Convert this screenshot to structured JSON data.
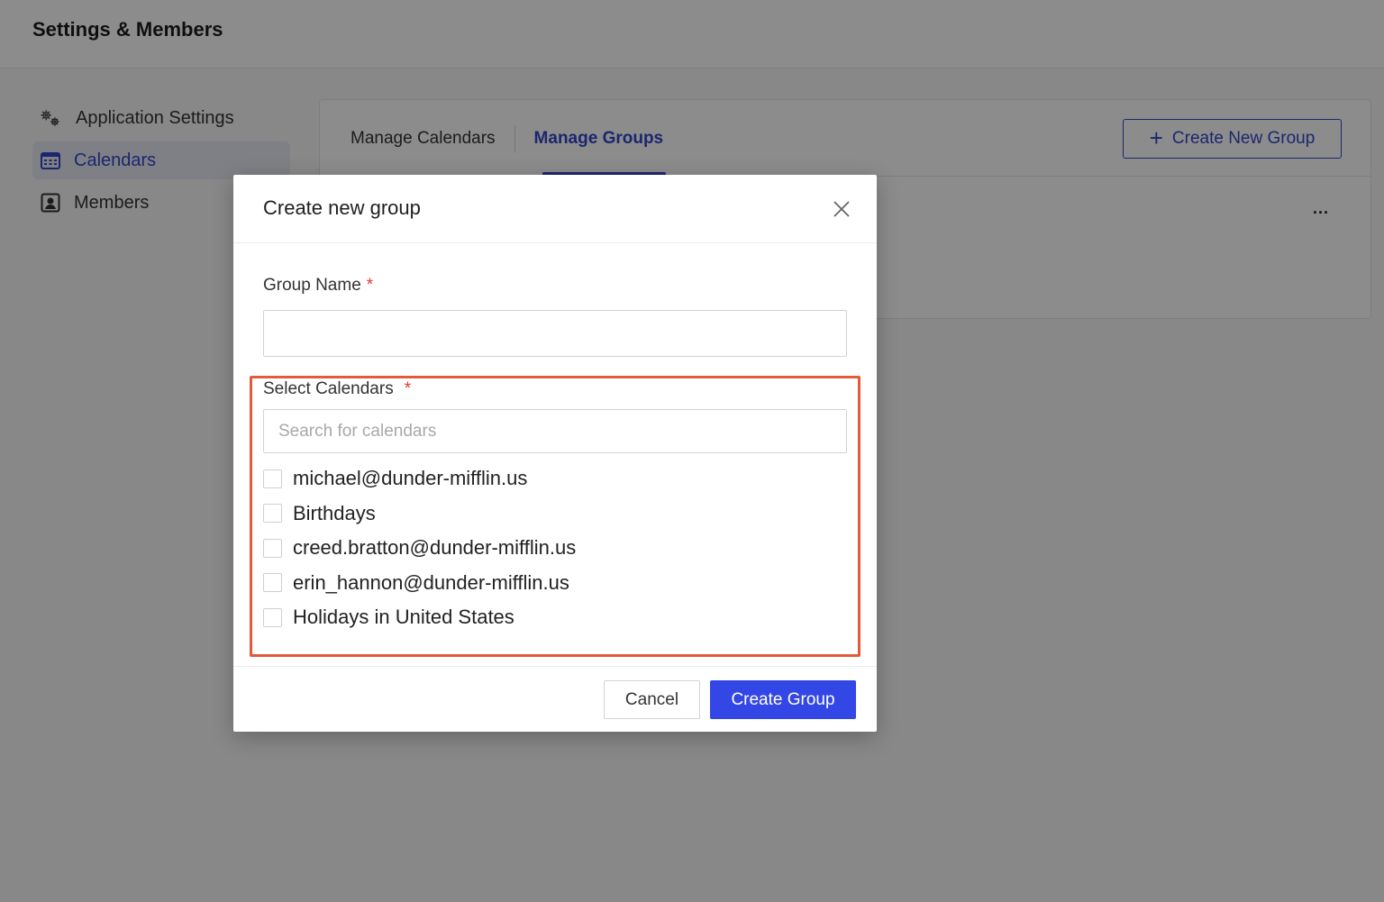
{
  "header": {
    "title": "Settings & Members"
  },
  "sidebar": {
    "items": [
      {
        "label": "Application Settings",
        "icon": "gears-icon",
        "active": false
      },
      {
        "label": "Calendars",
        "icon": "calendar-icon",
        "active": true
      },
      {
        "label": "Members",
        "icon": "member-icon",
        "active": false
      }
    ]
  },
  "tabs": [
    {
      "label": "Manage Calendars",
      "active": false
    },
    {
      "label": "Manage Groups",
      "active": true
    }
  ],
  "actions": {
    "create_new_group_label": "Create New Group",
    "more_label": "..."
  },
  "modal": {
    "title": "Create new group",
    "group_name_label": "Group Name",
    "group_name_value": "",
    "select_calendars_label": "Select Calendars",
    "required_mark": "*",
    "search_placeholder": "Search for calendars",
    "calendars": [
      {
        "label": "michael@dunder-mifflin.us",
        "checked": false
      },
      {
        "label": "Birthdays",
        "checked": false
      },
      {
        "label": "creed.bratton@dunder-mifflin.us",
        "checked": false
      },
      {
        "label": "erin_hannon@dunder-mifflin.us",
        "checked": false
      },
      {
        "label": "Holidays in United States",
        "checked": false
      }
    ],
    "cancel_label": "Cancel",
    "create_label": "Create Group"
  },
  "colors": {
    "accent": "#3346e6",
    "highlight": "#e35b3a",
    "required": "#e03a2e"
  }
}
